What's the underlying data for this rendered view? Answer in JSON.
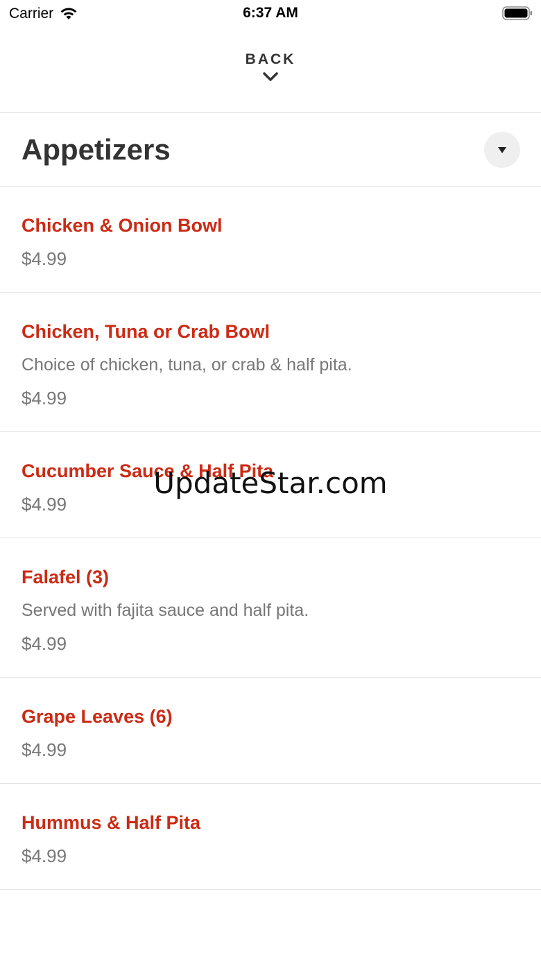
{
  "status_bar": {
    "carrier": "Carrier",
    "time": "6:37 AM"
  },
  "nav": {
    "back_label": "BACK",
    "back_icon": "chevron-down-icon"
  },
  "category": {
    "title": "Appetizers",
    "dropdown_icon": "caret-down-icon"
  },
  "menu_items": [
    {
      "name": "Chicken & Onion Bowl",
      "description": "",
      "price": "$4.99"
    },
    {
      "name": "Chicken, Tuna or Crab Bowl",
      "description": "Choice of chicken, tuna, or crab & half pita.",
      "price": "$4.99"
    },
    {
      "name": "Cucumber Sauce & Half Pita",
      "description": "",
      "price": "$4.99"
    },
    {
      "name": "Falafel (3)",
      "description": "Served with fajita sauce and half pita.",
      "price": "$4.99"
    },
    {
      "name": "Grape Leaves (6)",
      "description": "",
      "price": "$4.99"
    },
    {
      "name": "Hummus & Half Pita",
      "description": "",
      "price": "$4.99"
    }
  ],
  "watermark": "UpdateStar.com",
  "colors": {
    "item_name": "#cc2a14",
    "secondary_text": "#777777",
    "title_text": "#333333",
    "divider": "#e4e4e4"
  }
}
